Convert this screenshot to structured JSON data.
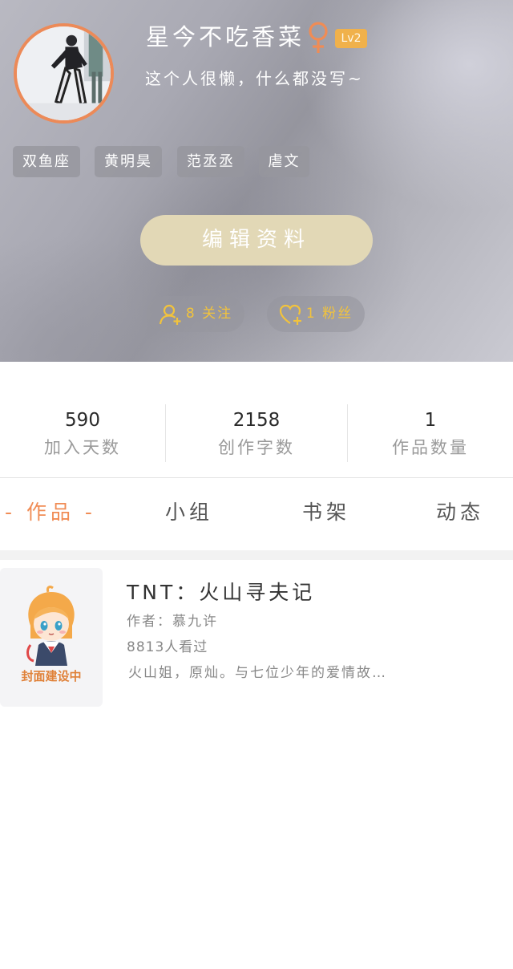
{
  "profile": {
    "nickname": "星今不吃香菜",
    "gender_icon": "female-symbol-icon",
    "level": "Lv2",
    "bio": "这个人很懒，什么都没写~",
    "tags": [
      "双鱼座",
      "黄明昊",
      "范丞丞",
      "虐文"
    ],
    "edit_button_label": "编辑资料",
    "following_label": "8 关注",
    "fans_label": "1 粉丝"
  },
  "stats": [
    {
      "value": "590",
      "label": "加入天数"
    },
    {
      "value": "2158",
      "label": "创作字数"
    },
    {
      "value": "1",
      "label": "作品数量"
    }
  ],
  "tabs": [
    {
      "label": "- 作品 -",
      "active": true
    },
    {
      "label": "小组",
      "active": false
    },
    {
      "label": "书架",
      "active": false
    },
    {
      "label": "动态",
      "active": false
    }
  ],
  "works": [
    {
      "title": "TNT：火山寻夫记",
      "author": "作者：慕九许",
      "views": "8813人看过",
      "description": "火山姐，原灿。与七位少年的爱情故…",
      "cover_text": "封面建设中"
    }
  ],
  "colors": {
    "accent_orange": "#f08c55",
    "avatar_border": "#ec8a58",
    "level_badge": "#f0b14b",
    "edit_button": "#e2d8b6",
    "follow_text": "#f2c33c",
    "gender_icon": "#f08c55"
  }
}
